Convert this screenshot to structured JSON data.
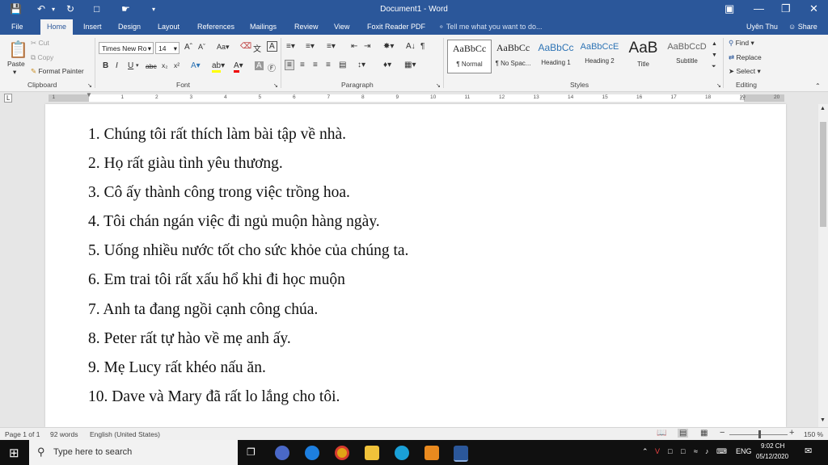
{
  "app": {
    "title": "Document1 - Word",
    "user": "Uyên Thu",
    "share": "Share"
  },
  "tabs": [
    "File",
    "Home",
    "Insert",
    "Design",
    "Layout",
    "References",
    "Mailings",
    "Review",
    "View",
    "Foxit Reader PDF"
  ],
  "tell_me": "Tell me what you want to do...",
  "clipboard": {
    "paste": "Paste",
    "cut": "Cut",
    "copy": "Copy",
    "format_painter": "Format Painter",
    "label": "Clipboard"
  },
  "font": {
    "name": "Times New Ro",
    "size": "14",
    "label": "Font"
  },
  "paragraph": {
    "label": "Paragraph"
  },
  "styles": {
    "label": "Styles",
    "items": [
      {
        "preview": "AaBbCc",
        "name": "¶ Normal"
      },
      {
        "preview": "AaBbCc",
        "name": "¶ No Spac..."
      },
      {
        "preview": "AaBbCc",
        "name": "Heading 1"
      },
      {
        "preview": "AaBbCcE",
        "name": "Heading 2"
      },
      {
        "preview": "AaB",
        "name": "Title"
      },
      {
        "preview": "AaBbCcD",
        "name": "Subtitle"
      }
    ]
  },
  "editing": {
    "find": "Find",
    "replace": "Replace",
    "select": "Select",
    "label": "Editing"
  },
  "document": {
    "lines": [
      "1. Chúng tôi rất thích làm bài tập về nhà.",
      "2. Họ rất giàu tình yêu thương.",
      "3. Cô ấy thành công trong việc trồng hoa.",
      "4. Tôi chán ngán việc đi ngủ muộn hàng ngày.",
      "5. Uống nhiều nước tốt cho sức khỏe của chúng ta.",
      "6. Em trai tôi rất xấu hổ khi đi học muộn",
      "7. Anh ta đang ngồi cạnh công chúa.",
      "8. Peter rất tự hào về mẹ anh ấy.",
      "9. Mẹ Lucy rất khéo nấu ăn.",
      "10. Dave và Mary đã rất lo lắng cho tôi."
    ]
  },
  "status": {
    "page": "Page 1 of 1",
    "words": "92 words",
    "language": "English (United States)",
    "zoom": "150 %"
  },
  "taskbar": {
    "search_placeholder": "Type here to search",
    "lang": "ENG",
    "time": "9:02 CH",
    "date": "05/12/2020"
  }
}
